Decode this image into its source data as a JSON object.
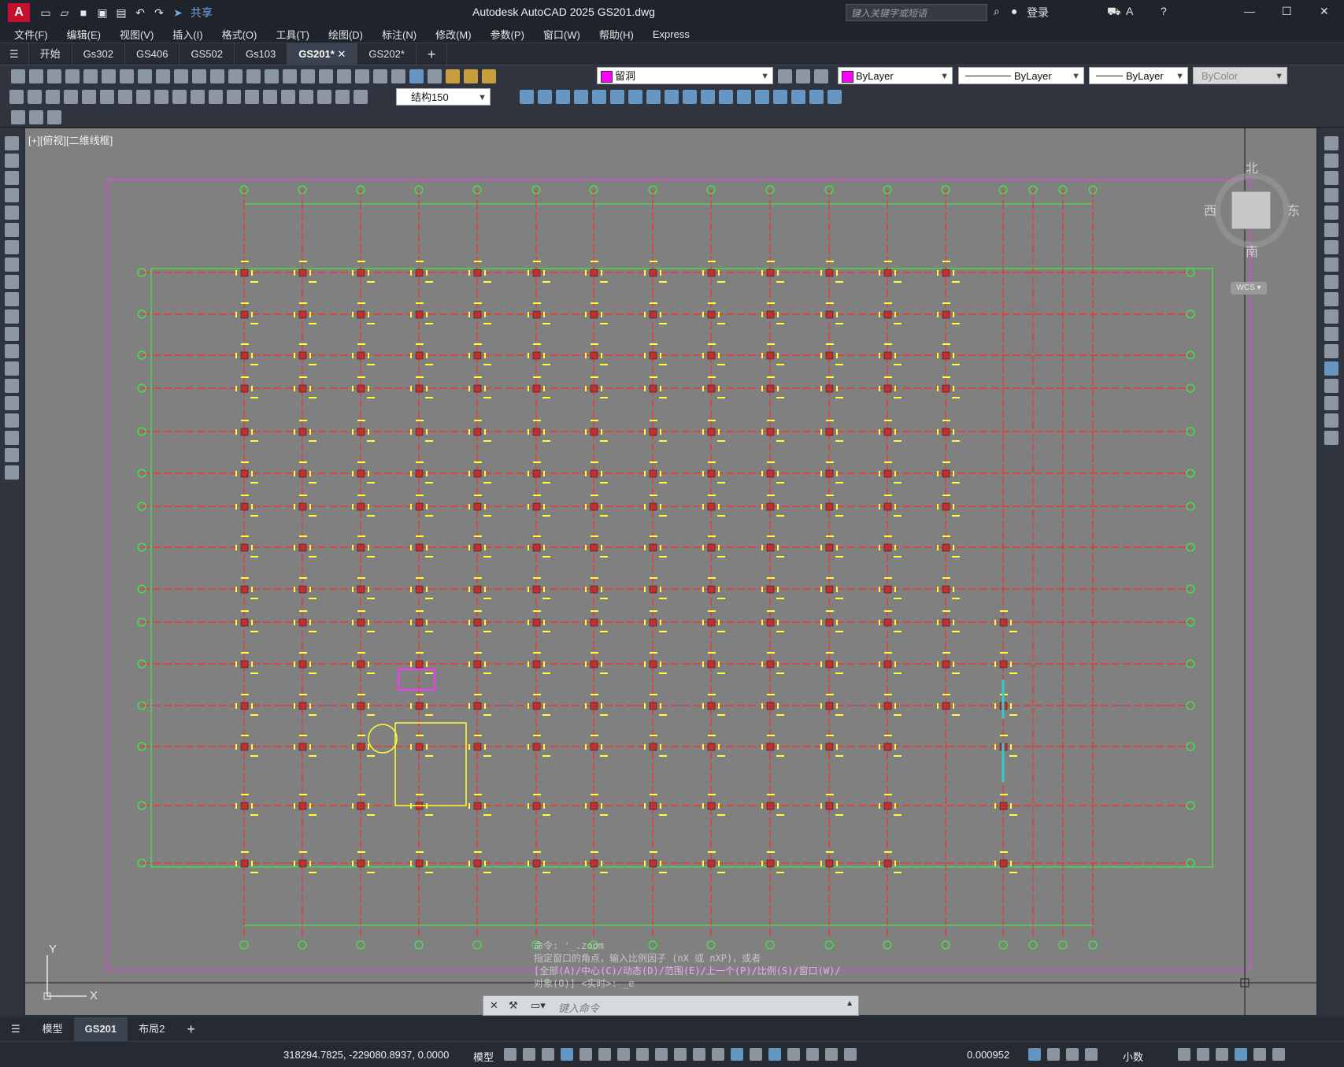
{
  "title_bar": {
    "logo": "A",
    "share_label": "共享",
    "window_title": "Autodesk AutoCAD 2025    GS201.dwg",
    "search_placeholder": "键入关键字或短语",
    "login_label": "登录"
  },
  "menu": [
    "文件(F)",
    "编辑(E)",
    "视图(V)",
    "插入(I)",
    "格式(O)",
    "工具(T)",
    "绘图(D)",
    "标注(N)",
    "修改(M)",
    "参数(P)",
    "窗口(W)",
    "帮助(H)",
    "Express"
  ],
  "doc_tabs": [
    {
      "label": "开始",
      "active": false
    },
    {
      "label": "Gs302",
      "active": false
    },
    {
      "label": "GS406",
      "active": false
    },
    {
      "label": "GS502",
      "active": false
    },
    {
      "label": "Gs103",
      "active": false
    },
    {
      "label": "GS201*",
      "active": true
    },
    {
      "label": "GS202*",
      "active": false
    }
  ],
  "properties": {
    "layer": "留洞",
    "color": "ByLayer",
    "linetype": "ByLayer",
    "lineweight": "ByLayer",
    "plotstyle": "ByColor",
    "dimstyle": "结构150"
  },
  "viewport": {
    "label": "[+][俯视][二维线框]",
    "compass": {
      "north": "北",
      "south": "南",
      "east": "东",
      "west": "西"
    },
    "ucs_label": "WCS",
    "y_axis": "Y",
    "x_axis": "X"
  },
  "command": {
    "history": [
      "命令: '_.zoom",
      "指定窗口的角点，输入比例因子 (nX 或 nXP)，或者",
      "[全部(A)/中心(C)/动态(D)/范围(E)/上一个(P)/比例(S)/窗口(W)/",
      "对象(O)] <实时>: _e"
    ],
    "placeholder": "键入命令"
  },
  "layout_tabs": [
    {
      "label": "模型",
      "active": false
    },
    {
      "label": "GS201",
      "active": true
    },
    {
      "label": "布局2",
      "active": false
    }
  ],
  "status": {
    "coordinates": "318294.7825, -229080.8937, 0.0000",
    "mode": "模型",
    "scale": "0.000952",
    "units": "小数"
  },
  "colors": {
    "canvas": "#808080",
    "grid_line": "#ff2a2a",
    "dimension": "#33ff33",
    "border": "#ff33ff",
    "annotation": "#ffff33"
  }
}
